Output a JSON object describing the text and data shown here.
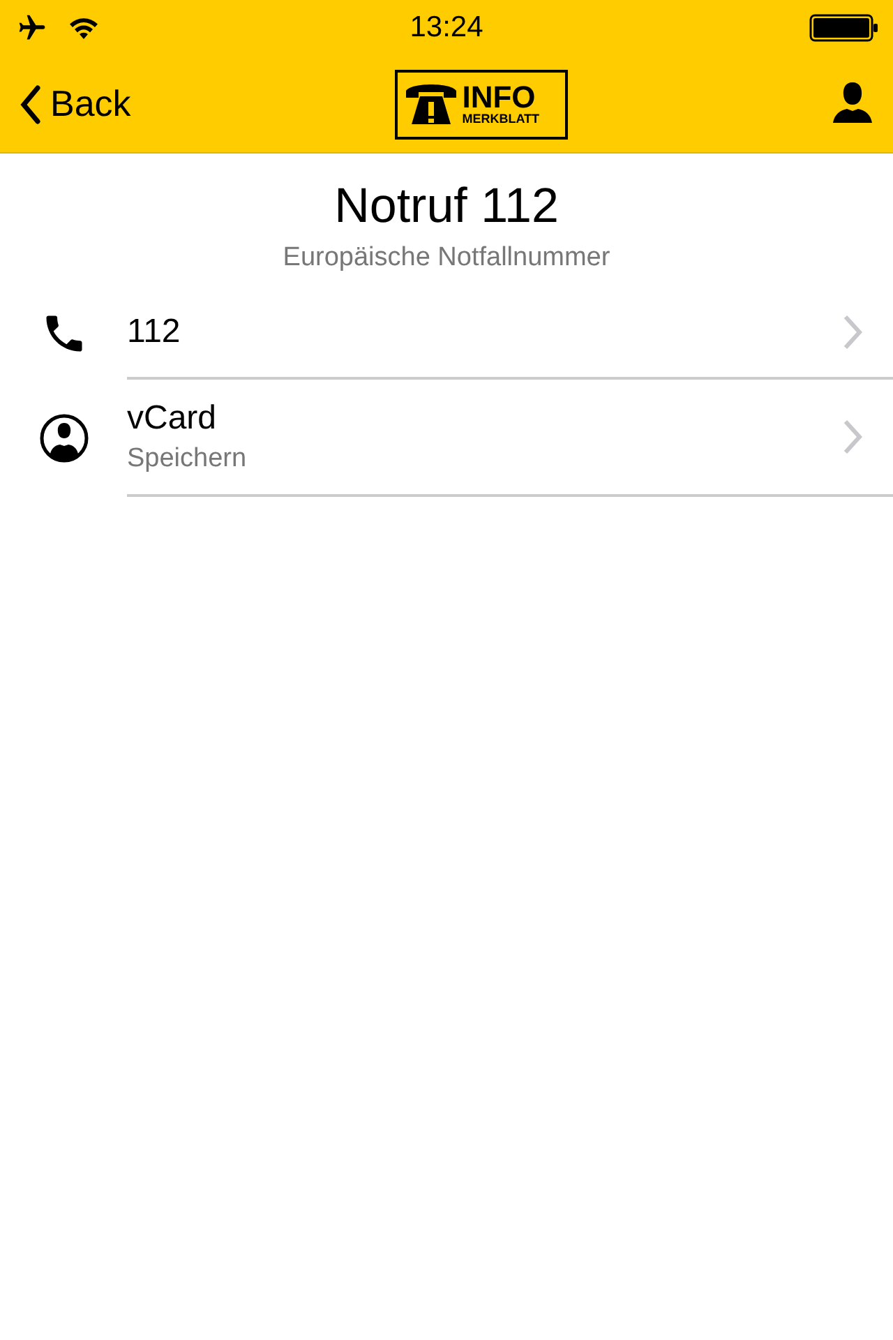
{
  "status_bar": {
    "time": "13:24"
  },
  "nav_bar": {
    "back": "Back",
    "logo": {
      "title": "INFO",
      "subtitle": "MERKBLATT"
    }
  },
  "header": {
    "title": "Notruf 112",
    "subtitle": "Europäische Notfallnummer"
  },
  "rows": [
    {
      "kind": "phone",
      "title": "112"
    },
    {
      "kind": "contact",
      "title": "vCard",
      "subtitle": "Speichern"
    }
  ]
}
